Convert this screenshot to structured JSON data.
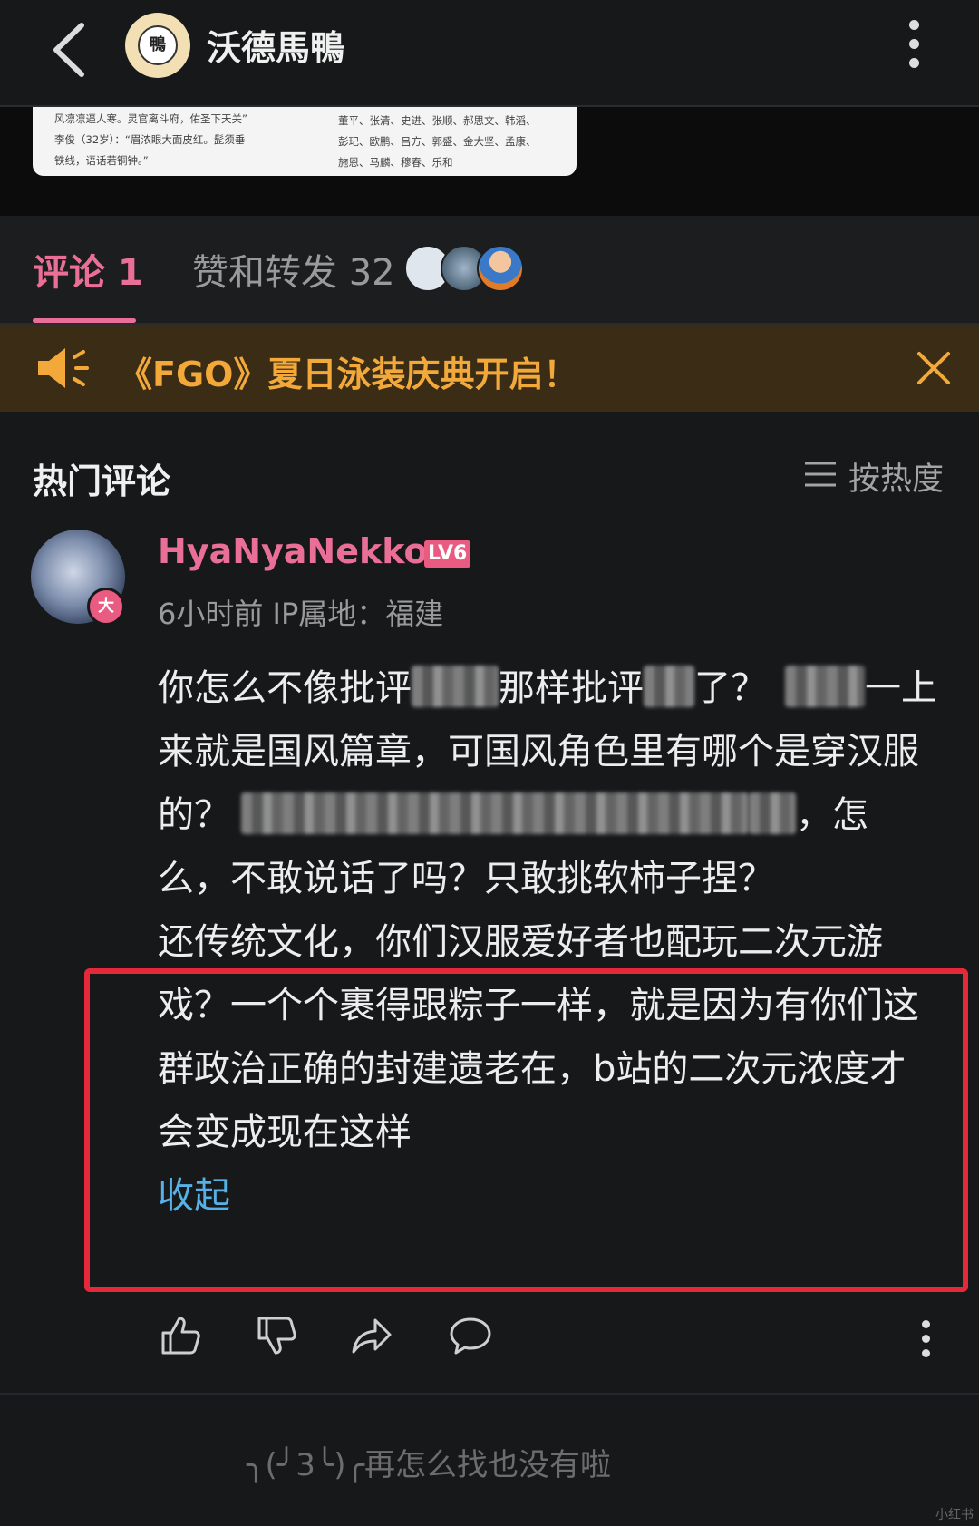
{
  "header": {
    "title": "沃德馬鴨",
    "avatar_text": "鴨"
  },
  "post_image": {
    "left_lines": [
      "风凛凛逼人寒。灵官离斗府，佑圣下天关”",
      "李俊（32岁）：“眉浓眼大面皮红。髭须垂",
      "铁线，语话若铜钟。”"
    ],
    "right_lines": [
      "董平、张清、史进、张顺、郝思文、韩滔、",
      "彭玘、欧鹏、吕方、郭盛、金大坚、孟康、",
      "施恩、马麟、穆春、乐和"
    ]
  },
  "tabs": {
    "comments_label": "评论 1",
    "likes_label": "赞和转发 32"
  },
  "banner": {
    "text": "《FGO》夏日泳装庆典开启！"
  },
  "section": {
    "title": "热门评论",
    "sort_label": "按热度"
  },
  "comment": {
    "username": "HyaNyaNekko",
    "level": "LV6",
    "badge": "大",
    "meta": "6小时前  IP属地：福建",
    "text_part1a": "你怎么不像批评",
    "text_part1b": "那样批评",
    "text_part1c": "了？",
    "text_part2": "一上来就是国风篇章，可国风角色里有哪个是穿汉服的？",
    "text_part3": "，怎么，不敢说话了吗？只敢挑软柿子捏？",
    "highlighted": "还传统文化，你们汉服爱好者也配玩二次元游戏？一个个裹得跟粽子一样，就是因为有你们这群政治正确的封建遗老在，b站的二次元浓度才会变成现在这样",
    "collapse": "收起"
  },
  "footer": {
    "text": "╮(╯3╰)╭再怎么找也没有啦",
    "watermark": "小红书"
  },
  "colors": {
    "accent_pink": "#ea6f97",
    "banner_orange": "#f3a93a",
    "highlight_red": "#e5293a",
    "link_blue": "#56b2e6"
  },
  "icons": [
    "back-icon",
    "more-vertical-icon",
    "speaker-icon",
    "close-icon",
    "menu-lines-icon",
    "thumbs-up-icon",
    "thumbs-down-icon",
    "share-icon",
    "comment-icon"
  ]
}
